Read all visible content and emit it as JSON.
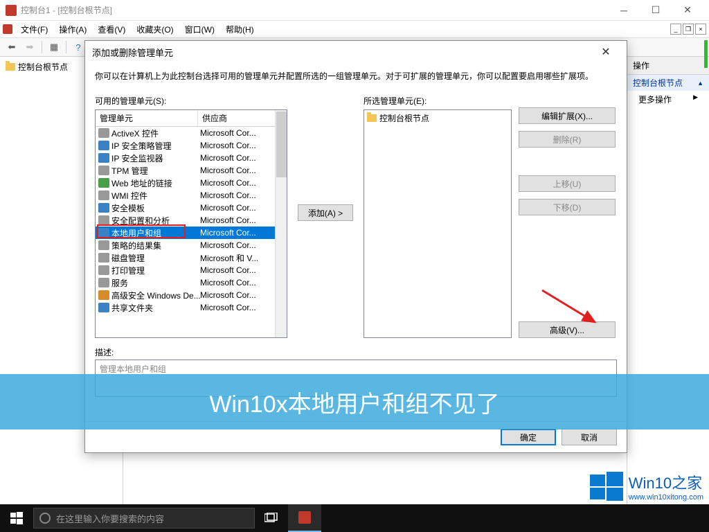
{
  "window": {
    "title": "控制台1 - [控制台根节点]",
    "menus": [
      "文件(F)",
      "操作(A)",
      "查看(V)",
      "收藏夹(O)",
      "窗口(W)",
      "帮助(H)"
    ]
  },
  "tree": {
    "root": "控制台根节点"
  },
  "actions_panel": {
    "header": "操作",
    "group": "控制台根节点",
    "item": "更多操作"
  },
  "dialog": {
    "title": "添加或删除管理单元",
    "description": "你可以在计算机上为此控制台选择可用的管理单元并配置所选的一组管理单元。对于可扩展的管理单元，你可以配置要启用哪些扩展项。",
    "available_label": "可用的管理单元(S):",
    "selected_label": "所选管理单元(E):",
    "col_name": "管理单元",
    "col_vendor": "供应商",
    "snapins": [
      {
        "name": "ActiveX 控件",
        "vendor": "Microsoft Cor..."
      },
      {
        "name": "IP 安全策略管理",
        "vendor": "Microsoft Cor..."
      },
      {
        "name": "IP 安全监视器",
        "vendor": "Microsoft Cor..."
      },
      {
        "name": "TPM 管理",
        "vendor": "Microsoft Cor..."
      },
      {
        "name": "Web 地址的链接",
        "vendor": "Microsoft Cor..."
      },
      {
        "name": "WMI 控件",
        "vendor": "Microsoft Cor..."
      },
      {
        "name": "安全模板",
        "vendor": "Microsoft Cor..."
      },
      {
        "name": "安全配置和分析",
        "vendor": "Microsoft Cor..."
      },
      {
        "name": "本地用户和组",
        "vendor": "Microsoft Cor..."
      },
      {
        "name": "策略的结果集",
        "vendor": "Microsoft Cor..."
      },
      {
        "name": "磁盘管理",
        "vendor": "Microsoft 和 V..."
      },
      {
        "name": "打印管理",
        "vendor": "Microsoft Cor..."
      },
      {
        "name": "服务",
        "vendor": "Microsoft Cor..."
      },
      {
        "name": "高级安全 Windows De...",
        "vendor": "Microsoft Cor..."
      },
      {
        "name": "共享文件夹",
        "vendor": "Microsoft Cor..."
      }
    ],
    "selected_root": "控制台根节点",
    "add_btn": "添加(A) >",
    "buttons": {
      "edit_ext": "编辑扩展(X)...",
      "remove": "删除(R)",
      "move_up": "上移(U)",
      "move_down": "下移(D)",
      "advanced": "高级(V)..."
    },
    "desc_label": "描述:",
    "desc_text": "管理本地用户和组",
    "ok": "确定",
    "cancel": "取消"
  },
  "banner": "Win10x本地用户和组不见了",
  "brand": {
    "name": "Win10之家",
    "url": "www.win10xitong.com"
  },
  "taskbar": {
    "search_placeholder": "在这里输入你要搜索的内容"
  }
}
